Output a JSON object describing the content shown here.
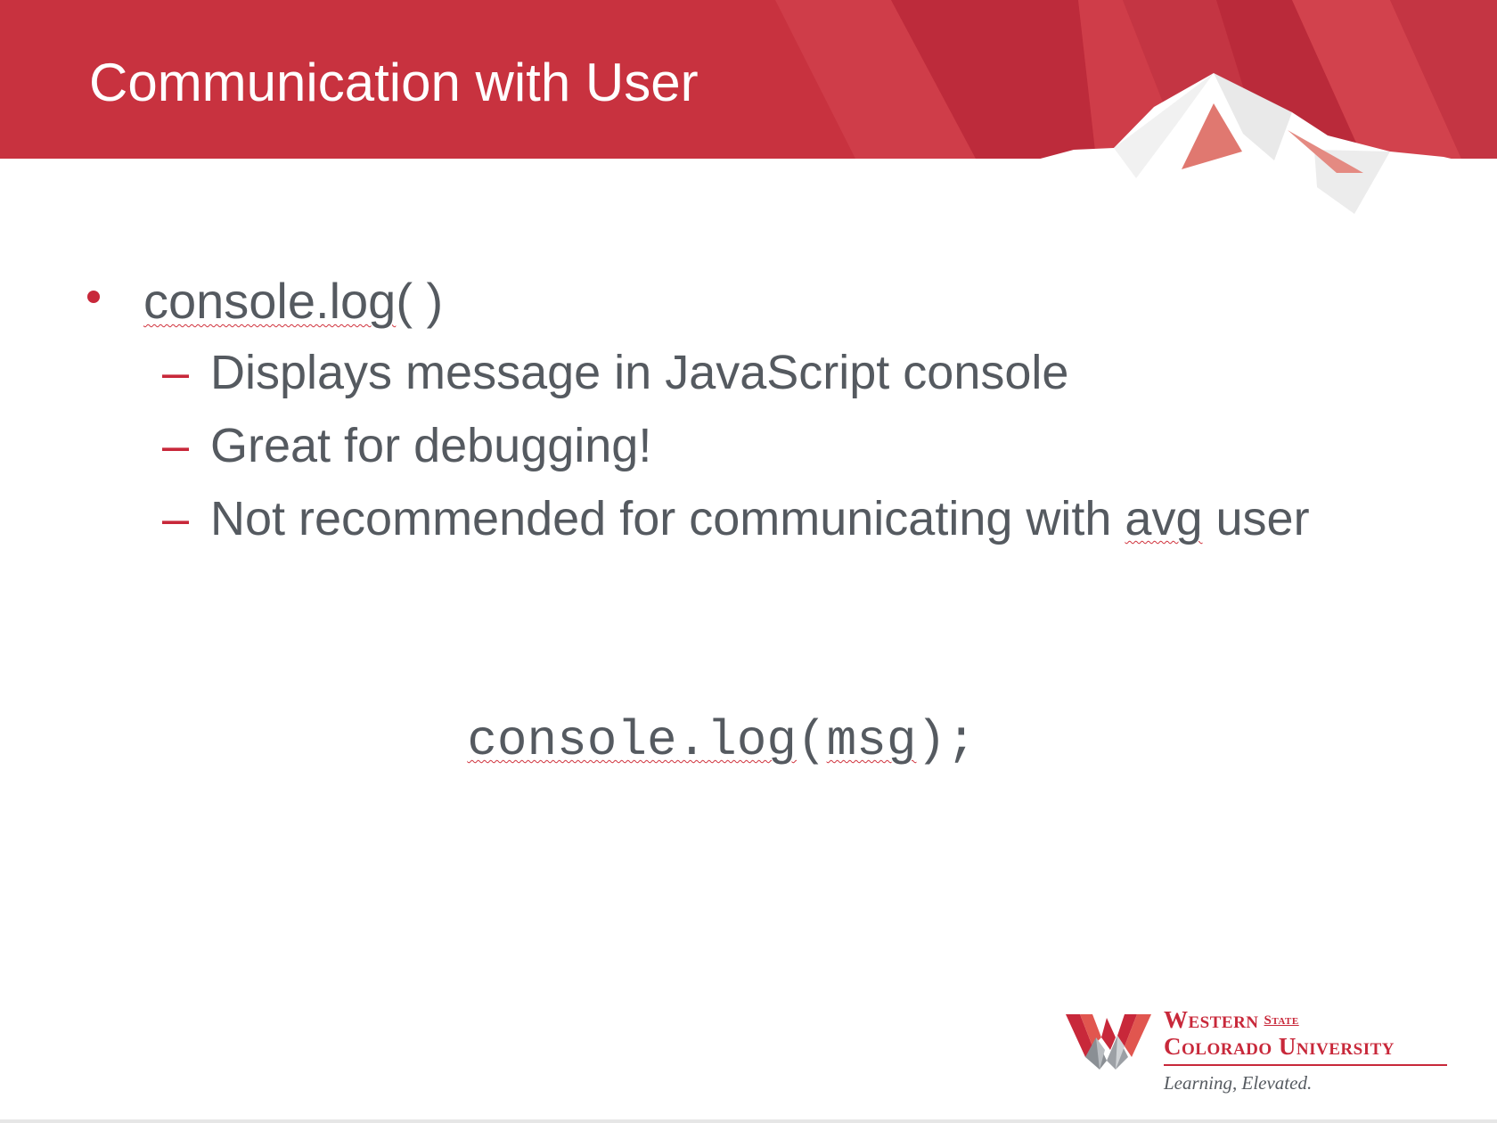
{
  "slide": {
    "title": "Communication with User",
    "bullet": {
      "before_squiggle": "",
      "squiggle_word": "console.log",
      "after_squiggle": "( )"
    },
    "sub_bullets": [
      "Displays message in JavaScript console",
      "Great for debugging!",
      "Not recommended for communicating with avg user"
    ],
    "sub_bullet_3_parts": {
      "before": "Not recommended for communicating with ",
      "squiggle": "avg",
      "after": " user"
    },
    "code": {
      "part_1": "console.log",
      "part_2": "(",
      "part_3": "msg",
      "part_4": ");"
    }
  },
  "logo": {
    "line_1": "Western",
    "line_1_small": "State",
    "line_2": "Colorado University",
    "tagline": "Learning, Elevated."
  },
  "colors": {
    "brand_red": "#c8283a",
    "text_gray": "#555a60"
  },
  "icons": {
    "bullet": "bullet-dot-icon",
    "sub_bullet": "dash-icon",
    "logo_mark": "w-mountain-logo-icon"
  }
}
